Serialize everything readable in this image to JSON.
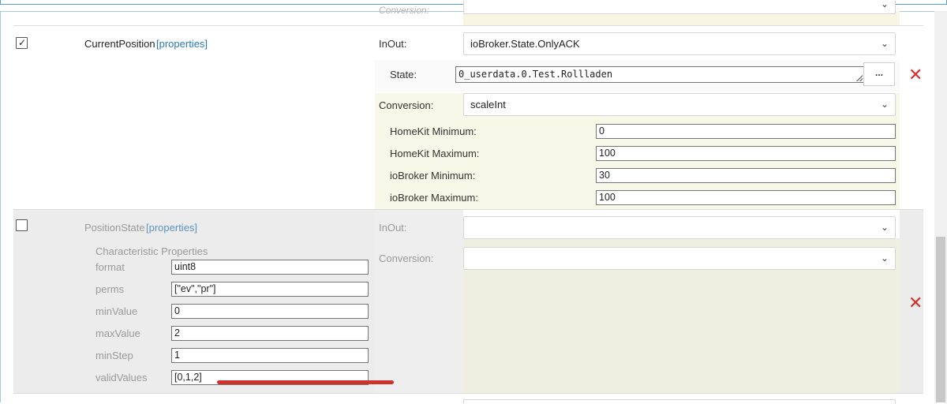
{
  "header_cut": {
    "conversion_label": "Conversion:"
  },
  "rows": [
    {
      "checked": true,
      "name": "CurrentPosition",
      "properties_link": "[properties]",
      "inout_label": "InOut:",
      "inout_value": "ioBroker.State.OnlyACK",
      "state_label": "State:",
      "state_value": "0_userdata.0.Test.Rollladen",
      "browse_button": "...",
      "conversion_label": "Conversion:",
      "conversion_value": "scaleInt",
      "params": [
        {
          "label": "HomeKit Minimum:",
          "value": "0"
        },
        {
          "label": "HomeKit Maximum:",
          "value": "100"
        },
        {
          "label": "ioBroker Minimum:",
          "value": "30"
        },
        {
          "label": "ioBroker Maximum:",
          "value": "100"
        }
      ],
      "delete_icon": "✕"
    },
    {
      "checked": false,
      "name": "PositionState",
      "properties_link": "[properties]",
      "char_props_title": "Characteristic Properties",
      "props": [
        {
          "label": "format",
          "value": "uint8"
        },
        {
          "label": "perms",
          "value": "[\"ev\",\"pr\"]"
        },
        {
          "label": "minValue",
          "value": "0"
        },
        {
          "label": "maxValue",
          "value": "2"
        },
        {
          "label": "minStep",
          "value": "1"
        },
        {
          "label": "validValues",
          "value": "[0,1,2]"
        }
      ],
      "inout_label": "InOut:",
      "inout_value": "",
      "conversion_label": "Conversion:",
      "conversion_value": "",
      "delete_icon": "✕"
    }
  ],
  "colors": {
    "accent_link": "#2a7ab8",
    "delete_red": "#d2312d",
    "annotation_red": "#d0312d",
    "panel_yellow": "#f8f8e8"
  }
}
